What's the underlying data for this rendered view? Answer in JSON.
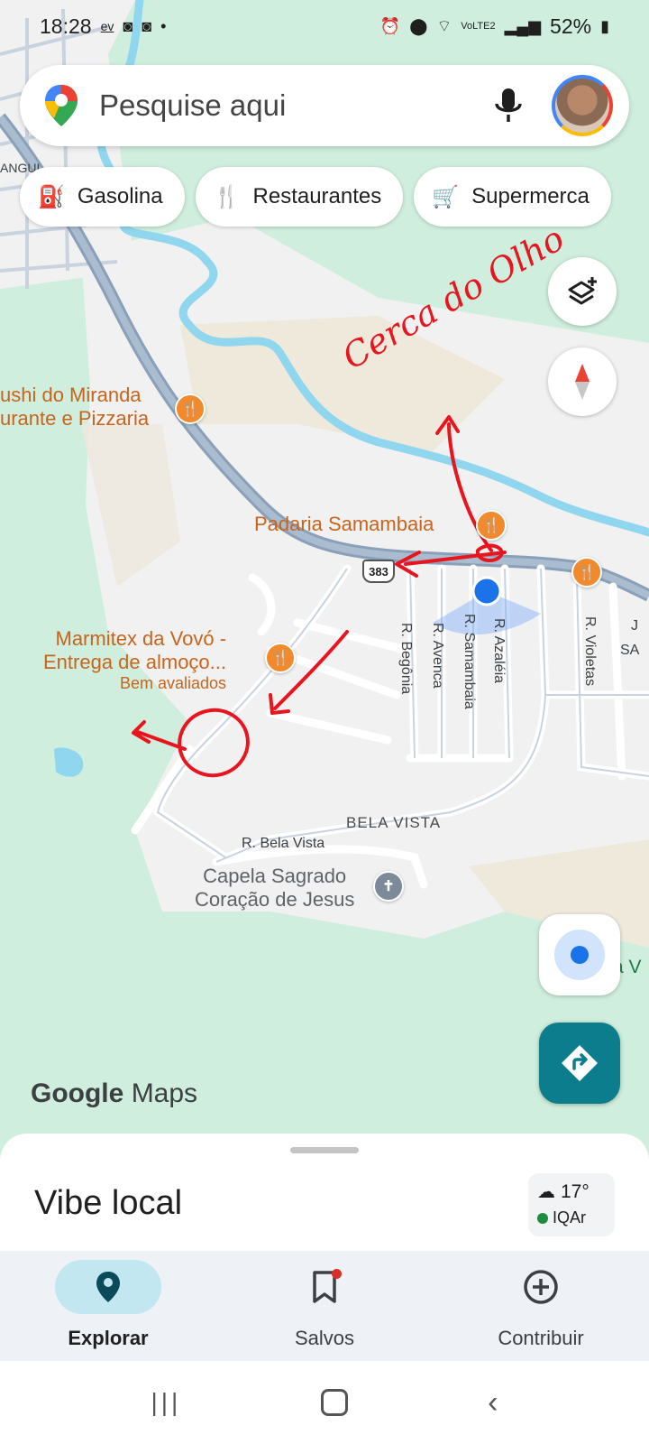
{
  "status_bar": {
    "time": "18:28",
    "carrier_badge": "ev",
    "battery": "52%",
    "network": "VoLTE2"
  },
  "search": {
    "placeholder": "Pesquise aqui"
  },
  "chips": [
    {
      "label": "Gasolina",
      "icon": "gas-station-icon"
    },
    {
      "label": "Restaurantes",
      "icon": "restaurant-icon"
    },
    {
      "label": "Supermerca",
      "icon": "cart-icon"
    }
  ],
  "map": {
    "pois": {
      "sushi_line1": "ushi do Miranda",
      "sushi_line2": "urante e Pizzaria",
      "padaria": "Padaria Samambaia",
      "marmitex_line1": "Marmitex da Vovó -",
      "marmitex_line2": "Entrega de almoço...",
      "marmitex_sub": "Bem avaliados",
      "capela_line1": "Capela Sagrado",
      "capela_line2": "Coração de Jesus"
    },
    "streets": {
      "begonia": "R. Begônia",
      "avenca": "R. Avenca",
      "samambaia": "R. Samambaia",
      "azaleia": "R. Azaléia",
      "violetas": "R. Violetas",
      "bela_vista_street": "R. Bela Vista",
      "sa_cut": "SA",
      "j_cut": "J",
      "a_v_cut": "a V",
      "top_cut": "ANGUI"
    },
    "area": "BELA VISTA",
    "route_number": "383",
    "handwritten_note": "Cerca do Olho"
  },
  "brand": {
    "logo_word1": "Google",
    "logo_word2": "Maps"
  },
  "sheet": {
    "title": "Vibe local",
    "weather_temp": "17°",
    "air_quality": "IQAr"
  },
  "nav": {
    "items": [
      {
        "label": "Explorar",
        "icon": "explore-pin-icon"
      },
      {
        "label": "Salvos",
        "icon": "bookmark-icon"
      },
      {
        "label": "Contribuir",
        "icon": "add-circle-icon"
      }
    ]
  },
  "colors": {
    "accent": "#0b7d8c",
    "location_dot": "#1a73e8",
    "poi_orange": "#f08a2c",
    "annotation_red": "#e8141e",
    "water": "#8fd6ee",
    "park": "#cfeedd"
  }
}
